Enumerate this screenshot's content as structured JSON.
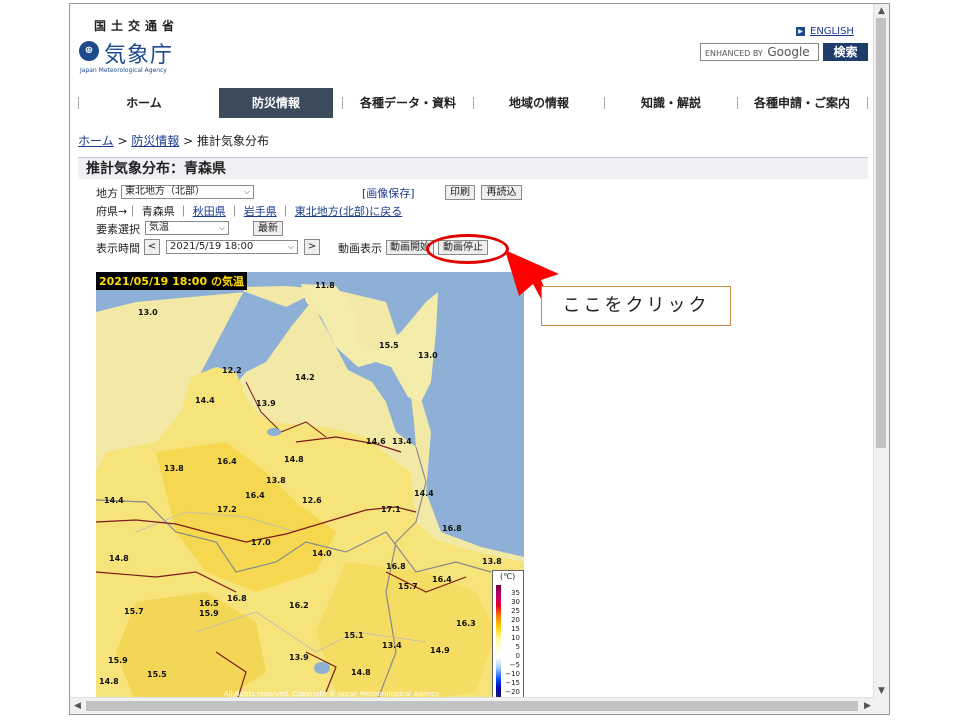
{
  "header": {
    "gov_name": "国土交通省",
    "logo_name": "気象庁",
    "logo_en": "Japan Meteorological Agency",
    "english_link": "ENGLISH",
    "search_brand_prefix": "ENHANCED BY",
    "search_brand": "Google",
    "search_button": "検索"
  },
  "nav": {
    "items": [
      {
        "label": "ホーム"
      },
      {
        "label": "防災情報"
      },
      {
        "label": "各種データ・資料"
      },
      {
        "label": "地域の情報"
      },
      {
        "label": "知識・解説"
      },
      {
        "label": "各種申請・ご案内"
      }
    ],
    "active_index": 1
  },
  "breadcrumb": {
    "home": "ホーム",
    "sep": " > ",
    "bousai": "防災情報",
    "current": "推計気象分布"
  },
  "page_title": "推計気象分布：青森県",
  "controls": {
    "region_label": "地方",
    "region_value": "東北地方（北部）",
    "save_image": "[画像保存]",
    "print": "印刷",
    "reload": "再読込",
    "pref_label": "府県→｜",
    "pref_current": "青森県",
    "pref_akita": "秋田県",
    "pref_iwate": "岩手県",
    "pref_back": "東北地方(北部)に戻る",
    "pipe": "｜",
    "element_label": "要素選択",
    "element_value": "気温",
    "latest": "最新",
    "time_label": "表示時間",
    "prev": "<",
    "time_value": "2021/5/19 18:00",
    "next": ">",
    "anim_label": "動画表示",
    "anim_start": "動画開始",
    "anim_stop": "動画停止"
  },
  "map": {
    "stamp": "2021/05/19 18:00 の気温",
    "copyright": "All rights reserved. Copyright © Japan Meteorological Agency",
    "temperatures": [
      "11.8",
      "13.0",
      "15.5",
      "13.0",
      "12.2",
      "14.2",
      "14.4",
      "13.9",
      "14.6",
      "13.4",
      "13.8",
      "16.4",
      "14.8",
      "13.8",
      "16.4",
      "12.6",
      "14.4",
      "14.4",
      "17.2",
      "17.1",
      "16.8",
      "17.0",
      "14.0",
      "14.8",
      "16.8",
      "13.8",
      "15.7",
      "16.4",
      "16.5",
      "15.9",
      "16.8",
      "15.7",
      "16.2",
      "15.1",
      "16.3",
      "13.4",
      "15.9",
      "15.5",
      "13.9",
      "14.8",
      "14.9",
      "14.8"
    ],
    "legend_unit": "(℃)",
    "legend_values": [
      "35",
      "30",
      "25",
      "20",
      "15",
      "10",
      "5",
      "0",
      "−5",
      "−10",
      "−15",
      "−20"
    ]
  },
  "annotation": {
    "callout": "ここをクリック"
  }
}
